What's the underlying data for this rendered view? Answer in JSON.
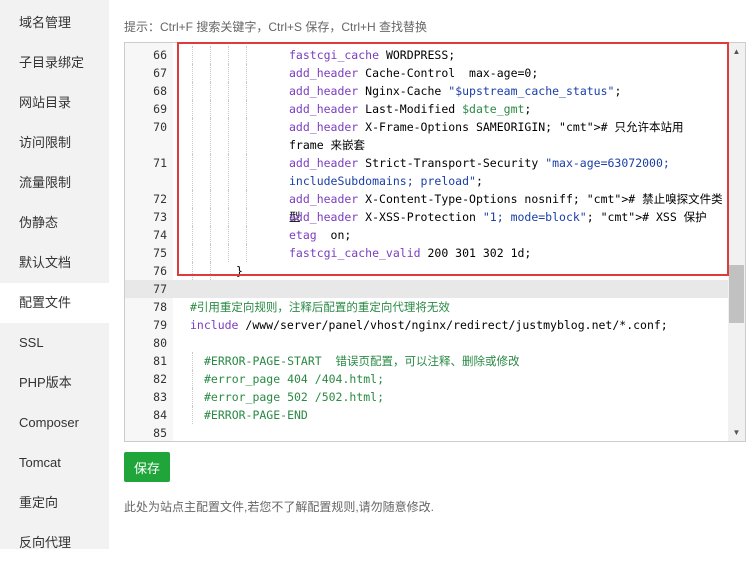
{
  "sidebar": {
    "items": [
      {
        "label": "域名管理"
      },
      {
        "label": "子目录绑定"
      },
      {
        "label": "网站目录"
      },
      {
        "label": "访问限制"
      },
      {
        "label": "流量限制"
      },
      {
        "label": "伪静态"
      },
      {
        "label": "默认文档"
      },
      {
        "label": "配置文件",
        "active": true
      },
      {
        "label": "SSL"
      },
      {
        "label": "PHP版本"
      },
      {
        "label": "Composer"
      },
      {
        "label": "Tomcat"
      },
      {
        "label": "重定向"
      },
      {
        "label": "反向代理"
      }
    ]
  },
  "hint": "提示：Ctrl+F 搜索关键字，Ctrl+S 保存，Ctrl+H 查找替换",
  "editor": {
    "lines": [
      {
        "num": "66",
        "indent": 4,
        "text": "fastcgi_cache WORDPRESS;"
      },
      {
        "num": "67",
        "indent": 4,
        "text": "add_header Cache-Control  max-age=0;"
      },
      {
        "num": "68",
        "indent": 4,
        "text": "add_header Nginx-Cache \"$upstream_cache_status\";"
      },
      {
        "num": "69",
        "indent": 4,
        "text": "add_header Last-Modified $date_gmt;"
      },
      {
        "num": "70",
        "indent": 4,
        "text": "add_header X-Frame-Options SAMEORIGIN; # 只允许本站用 frame 来嵌套",
        "wrap": true
      },
      {
        "num": "71",
        "indent": 4,
        "text": "add_header Strict-Transport-Security \"max-age=63072000; includeSubdomains; preload\";",
        "wrap": true
      },
      {
        "num": "72",
        "indent": 4,
        "text": "add_header X-Content-Type-Options nosniff; # 禁止嗅探文件类型"
      },
      {
        "num": "73",
        "indent": 4,
        "text": "add_header X-XSS-Protection \"1; mode=block\"; # XSS 保护"
      },
      {
        "num": "74",
        "indent": 4,
        "text": "etag  on;"
      },
      {
        "num": "75",
        "indent": 4,
        "text": "fastcgi_cache_valid 200 301 302 1d;"
      },
      {
        "num": "76",
        "indent": 2,
        "text": "}"
      },
      {
        "num": "77",
        "indent": 0,
        "text": "",
        "highlight": true
      },
      {
        "num": "78",
        "indent": 0,
        "text": "#引用重定向规则，注释后配置的重定向代理将无效"
      },
      {
        "num": "79",
        "indent": 0,
        "text": "include /www/server/panel/vhost/nginx/redirect/justmyblog.net/*.conf;"
      },
      {
        "num": "80",
        "indent": 0,
        "text": ""
      },
      {
        "num": "81",
        "indent": 1,
        "text": "#ERROR-PAGE-START  错误页配置，可以注释、删除或修改"
      },
      {
        "num": "82",
        "indent": 1,
        "text": "#error_page 404 /404.html;"
      },
      {
        "num": "83",
        "indent": 1,
        "text": "#error_page 502 /502.html;"
      },
      {
        "num": "84",
        "indent": 1,
        "text": "#ERROR-PAGE-END"
      },
      {
        "num": "85",
        "indent": 0,
        "text": ""
      }
    ]
  },
  "save_label": "保存",
  "note": "此处为站点主配置文件,若您不了解配置规则,请勿随意修改.",
  "colors": {
    "accent": "#20a53a",
    "highlight_border": "#e03b3b"
  }
}
